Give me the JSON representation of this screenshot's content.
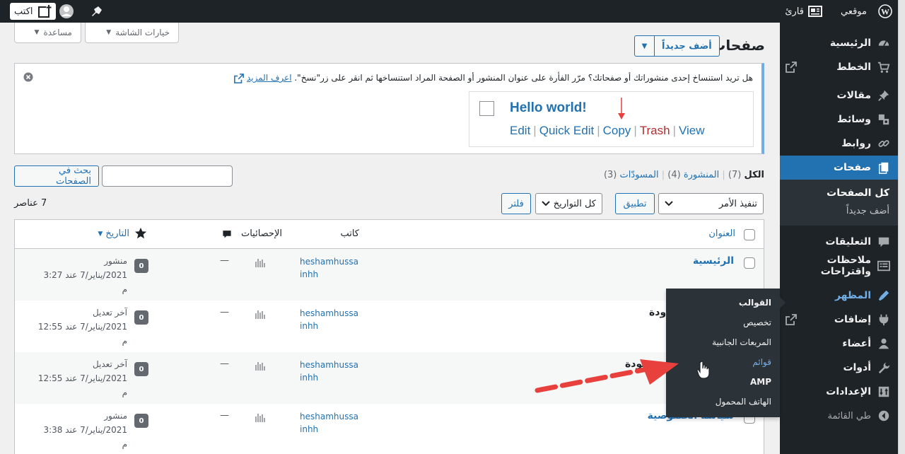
{
  "adminbar": {
    "site_name": "موقعي",
    "reader": "قارئ",
    "write": "اكتب"
  },
  "sidebar": {
    "items": [
      {
        "label": "الرئيسية",
        "icon": "dashboard-icon"
      },
      {
        "label": "الخطط",
        "icon": "cart-icon"
      },
      {
        "label": "مقالات",
        "icon": "pin-icon"
      },
      {
        "label": "وسائط",
        "icon": "media-icon"
      },
      {
        "label": "روابط",
        "icon": "link-icon"
      },
      {
        "label": "صفحات",
        "icon": "pages-icon"
      },
      {
        "label": "التعليقات",
        "icon": "comment-icon"
      },
      {
        "label": "ملاحظات واقتراحات",
        "icon": "feedback-icon"
      },
      {
        "label": "المظهر",
        "icon": "appearance-icon"
      },
      {
        "label": "إضافات",
        "icon": "plugins-icon"
      },
      {
        "label": "أعضاء",
        "icon": "users-icon"
      },
      {
        "label": "أدوات",
        "icon": "tools-icon"
      },
      {
        "label": "الإعدادات",
        "icon": "settings-icon"
      }
    ],
    "submenu": [
      "كل الصفحات",
      "أضف جديداً"
    ],
    "collapse": "طي القائمة"
  },
  "flyout": [
    "القوالب",
    "تخصيص",
    "المربعات الجانبية",
    "قوائم",
    "AMP",
    "الهاتف المحمول"
  ],
  "header": {
    "screen_options": "خيارات الشاشة",
    "help": "مساعدة",
    "title": "صفحات",
    "add_new": "أضف جديداً"
  },
  "notice": {
    "text": "هل تريد استنساخ إحدى منشوراتك أو صفحاتك؟ مرّر الفأرة على عنوان المنشور أو الصفحة المراد استنساخها ثم انقر على زر\"نسخ\".",
    "learn_more": "اعرف المزيد",
    "demo_title": "Hello world!",
    "demo_actions": [
      "Edit",
      "Quick Edit",
      "Copy",
      "Trash",
      "View"
    ]
  },
  "filters": {
    "all": "الكل",
    "all_count": "(7)",
    "published": "المنشورة",
    "published_count": "(4)",
    "drafts": "المسودّات",
    "drafts_count": "(3)",
    "search_button": "بحث في الصفحات",
    "bulk_action": "تنفيذ الأمر",
    "apply": "تطبيق",
    "all_dates": "كل التواريخ",
    "filter": "فلتر",
    "items_count": "7 عناصر"
  },
  "table": {
    "headers": {
      "title": "العنوان",
      "author": "كاتب",
      "stats": "الإحصائيات",
      "date": "التاريخ"
    },
    "rows": [
      {
        "title": "الرئيسية",
        "author": "heshamhussainhh",
        "stats": "—",
        "comments": "0",
        "status": "منشور",
        "date": "2021/يناير/7 عند 3:27",
        "ampm": "م"
      },
      {
        "title": "ودة",
        "author": "heshamhussainhh",
        "stats": "—",
        "comments": "0",
        "status": "آخر تعديل",
        "date": "2021/يناير/7 عند 12:55",
        "ampm": "م"
      },
      {
        "title": "سودة",
        "author": "heshamhussainhh",
        "stats": "—",
        "comments": "0",
        "status": "آخر تعديل",
        "date": "2021/يناير/7 عند 12:55",
        "ampm": "م"
      },
      {
        "title": "سياسة الخصوصية",
        "author": "heshamhussainhh",
        "stats": "—",
        "comments": "0",
        "status": "منشور",
        "date": "2021/يناير/7 عند 3:38",
        "ampm": "م"
      }
    ]
  },
  "colors": {
    "accent": "#2271b1",
    "sidebar": "#1d2327",
    "arrow": "#e8413d"
  }
}
